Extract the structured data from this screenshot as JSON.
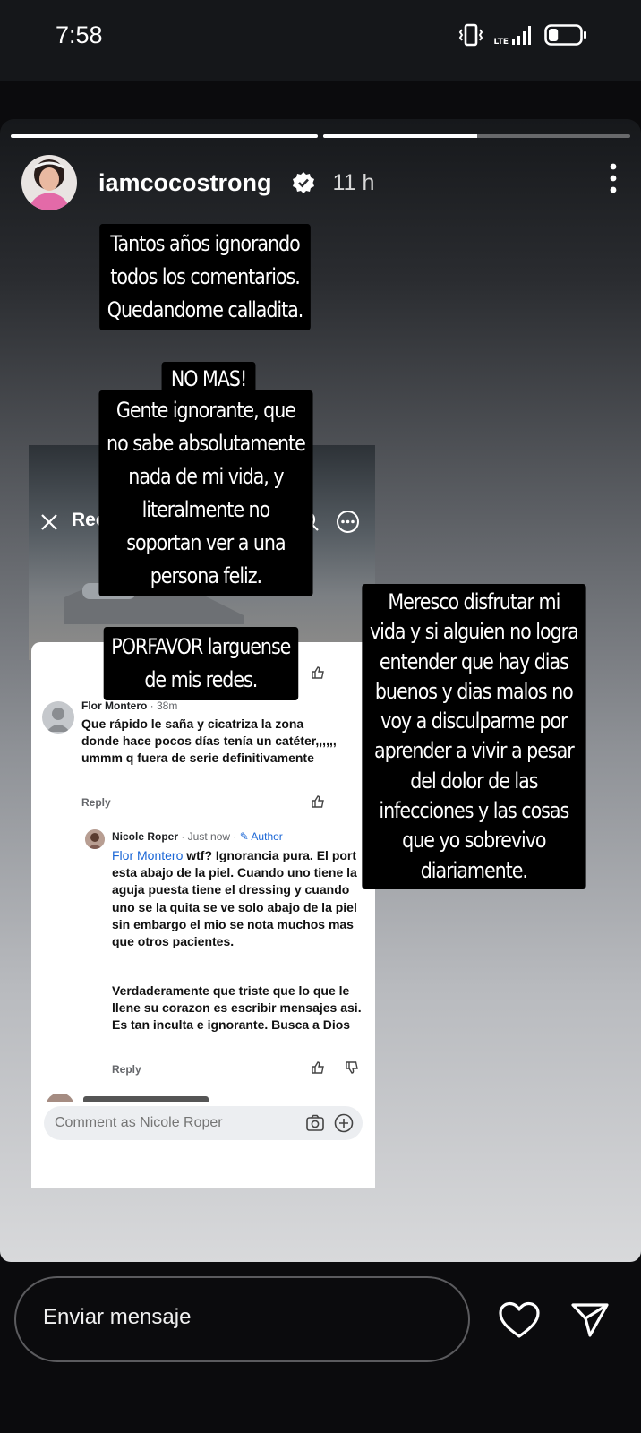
{
  "status_bar": {
    "time": "7:58",
    "network": "LTE",
    "battery_level": 0.3
  },
  "story": {
    "progress": [
      1.0,
      0.5
    ],
    "username": "iamcocostrong",
    "verified": true,
    "time_ago": "11 h",
    "overlay_1": [
      "Tantos años ignorando",
      "todos los comentarios.",
      "Quedandome calladita."
    ],
    "overlay_2_title": "NO MAS!",
    "overlay_2": [
      "Gente ignorante, que",
      "no sabe absolutamente",
      "nada de mi vida, y",
      "literalmente no",
      "soportan ver a una",
      "persona feliz."
    ],
    "overlay_3": [
      "PORFAVOR  larguense",
      "de mis redes."
    ],
    "overlay_4": [
      "Meresco disfrutar mi",
      "vida y si alguien no logra",
      "entender que hay dias",
      "buenos y dias malos no",
      "voy a disculparme por",
      "aprender a vivir a pesar",
      "del dolor de las",
      "infecciones y las cosas",
      "que yo sobrevivo",
      "diariamente."
    ]
  },
  "screenshot": {
    "title": "Ree",
    "partial_reply": "Re",
    "comment_1": {
      "author": "Flor Montero",
      "meta": " · 38m",
      "text": "Que rápido le saña y cicatriza la zona donde hace pocos días tenía un catéter,,,,,, ummm q fuera de serie definitivamente",
      "reply_label": "Reply"
    },
    "comment_2": {
      "author": "Nicole Roper",
      "meta": " · Just now · ",
      "badge": "✎ Author",
      "mention": "Flor Montero",
      "text_1": " wtf? Ignorancia pura. El port esta abajo de la piel. Cuando uno tiene la aguja puesta tiene el dressing y cuando uno se la quita se ve solo abajo de la piel sin embargo el mio se nota muchos mas que otros pacientes.",
      "text_2": "Verdaderamente que triste que lo que le llene su corazon es escribir mensajes asi. Es tan inculta e ignorante. Busca a Dios",
      "reply_label": "Reply"
    },
    "composer_placeholder": "Comment as Nicole Roper"
  },
  "bottom_bar": {
    "message_placeholder": "Enviar mensaje"
  },
  "icons": [
    "vibrate-icon",
    "signal-icon",
    "battery-icon",
    "verified-icon",
    "more-icon",
    "close-icon",
    "search-icon",
    "options-icon",
    "like-icon",
    "dislike-icon",
    "camera-icon",
    "add-icon",
    "heart-icon",
    "send-icon"
  ]
}
